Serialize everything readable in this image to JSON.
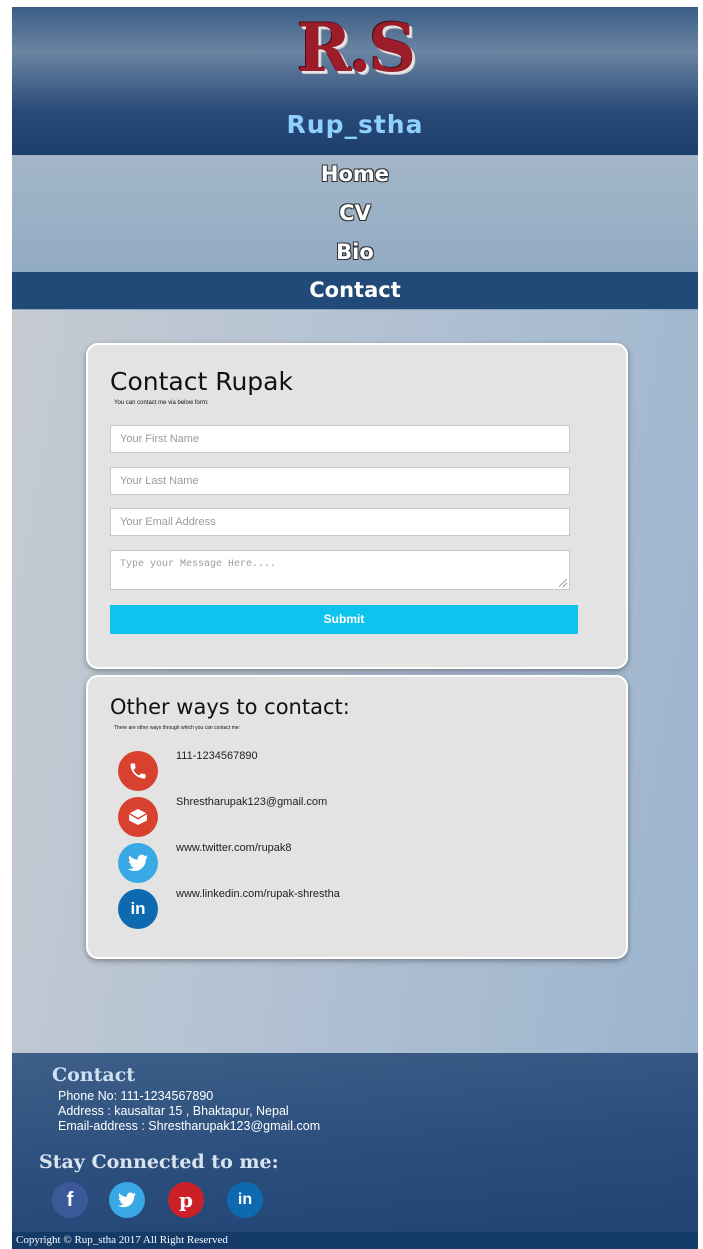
{
  "header": {
    "logo_text": "R.S",
    "site_name": "Rup_stha"
  },
  "nav": {
    "items": [
      {
        "label": "Home"
      },
      {
        "label": "CV"
      },
      {
        "label": "Bio"
      },
      {
        "label": "Contact"
      }
    ],
    "active": "Contact"
  },
  "contact_form": {
    "title": "Contact Rupak",
    "subtitle": "You can contact me via below form:",
    "first_name_placeholder": "Your First Name",
    "last_name_placeholder": "Your Last Name",
    "email_placeholder": "Your Email Address",
    "message_placeholder": "Type your Message Here....",
    "submit_label": "Submit"
  },
  "other_ways": {
    "title": "Other ways to contact:",
    "subtitle": "There are other ways through which you can contact me:",
    "items": [
      {
        "icon": "phone-icon",
        "text": "111-1234567890",
        "color": "#d9412f"
      },
      {
        "icon": "mail-icon",
        "text": "Shrestharupak123@gmail.com",
        "color": "#d9412f"
      },
      {
        "icon": "twitter-icon",
        "text": "www.twitter.com/rupak8",
        "color": "#39a9e6"
      },
      {
        "icon": "linkedin-icon",
        "text": "www.linkedin.com/rupak-shrestha",
        "color": "#0e6ab0"
      }
    ]
  },
  "footer": {
    "contact_title": "Contact",
    "phone": "Phone No: 111-1234567890",
    "address": "Address : kausaltar 15 , Bhaktapur, Nepal",
    "email": "Email-address : Shrestharupak123@gmail.com",
    "stay_connected": "Stay Connected to me:",
    "social": [
      {
        "icon": "facebook-icon",
        "color": "#3b5998"
      },
      {
        "icon": "twitter-icon",
        "color": "#39a9e6"
      },
      {
        "icon": "pinterest-icon",
        "color": "#cb2027"
      },
      {
        "icon": "linkedin-icon",
        "color": "#0e6ab0"
      }
    ],
    "copyright": "Copyright © Rup_stha 2017 All Right Reserved"
  }
}
